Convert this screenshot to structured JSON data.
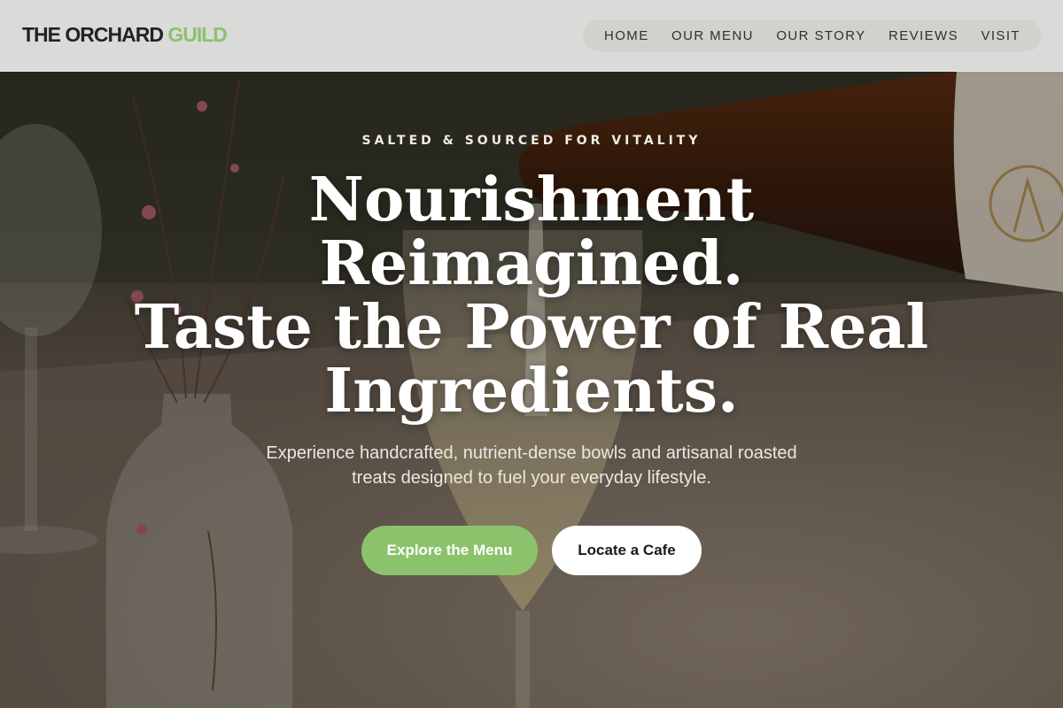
{
  "brand": {
    "name": "THE ORCHARD",
    "accent": "GUILD",
    "accent_color": "#8dc070"
  },
  "nav": {
    "items": [
      "HOME",
      "OUR MENU",
      "OUR STORY",
      "REVIEWS",
      "VISIT"
    ]
  },
  "hero": {
    "eyebrow": "SALTED & SOURCED FOR VITALITY",
    "headline": [
      "Nourishment",
      "Reimagined.",
      "Taste the Power of Real",
      "Ingredients."
    ],
    "subheadline_lines": [
      "Experience handcrafted, nutrient-dense bowls and artisanal roasted",
      "treats designed to fuel your everyday lifestyle."
    ],
    "primary_cta": "Explore the Menu",
    "secondary_cta": "Locate a Cafe",
    "primary_color": "#8cc26c"
  }
}
